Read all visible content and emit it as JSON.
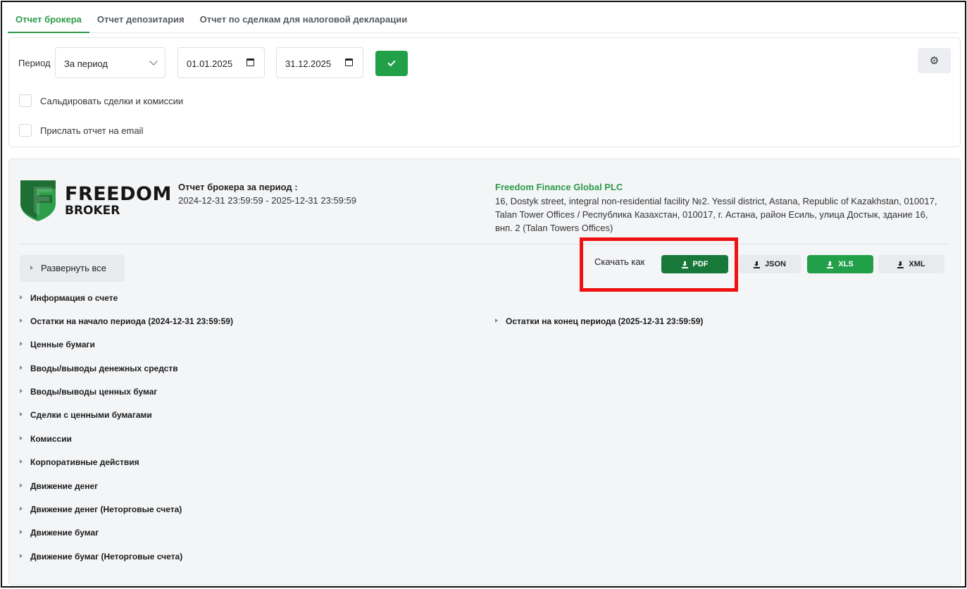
{
  "tabs": [
    {
      "label": "Отчет брокера",
      "active": true
    },
    {
      "label": "Отчет депозитария",
      "active": false
    },
    {
      "label": "Отчет по сделкам для налоговой декларации",
      "active": false
    }
  ],
  "filter": {
    "period_label": "Период",
    "period_select": "За период",
    "date_from": "01.01.2025",
    "date_to": "31.12.2025",
    "checkbox_netting": "Сальдировать сделки и комиссии",
    "checkbox_email": "Прислать отчет на email"
  },
  "report": {
    "logo_line1": "FREEDOM",
    "logo_line2": "BROKER",
    "period_title": "Отчет брокера за период :",
    "period_value": "2024-12-31 23:59:59 - 2025-12-31 23:59:59",
    "company_name": "Freedom Finance Global PLC",
    "company_address": "16, Dostyk street, integral non-residential facility №2. Yessil district, Astana, Republic of Kazakhstan, 010017, Talan Tower Offices / Республика Казахстан, 010017, г. Астана, район Есиль, улица Достык, здание 16, внп. 2 (Talan Towers Offices)",
    "expand_all": "Развернуть все",
    "download_label": "Скачать как",
    "download_buttons": {
      "pdf": "PDF",
      "json": "JSON",
      "xls": "XLS",
      "xml": "XML"
    },
    "sections_left": [
      "Информация о счете",
      "Остатки на начало периода (2024-12-31 23:59:59)",
      "Ценные бумаги",
      "Вводы/выводы денежных средств",
      "Вводы/выводы ценных бумаг",
      "Сделки с ценными бумагами",
      "Комиссии",
      "Корпоративные действия",
      "Движение денег",
      "Движение денег (Неторговые счета)",
      "Движение бумаг",
      "Движение бумаг (Неторговые счета)"
    ],
    "section_right": "Остатки на конец периода (2025-12-31 23:59:59)"
  },
  "colors": {
    "brand_green": "#22a049",
    "pdf_button": "#17783a",
    "highlight": "#ee1111"
  },
  "icons": [
    "chevron-down-icon",
    "calendar-icon",
    "check-icon",
    "gears-icon",
    "download-icon",
    "caret-right-icon"
  ]
}
